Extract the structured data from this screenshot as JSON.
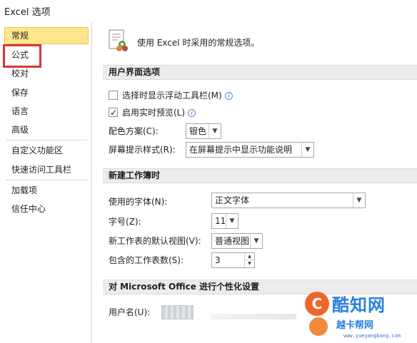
{
  "window": {
    "title": "Excel 选项"
  },
  "sidebar": {
    "items": [
      {
        "label": "常规"
      },
      {
        "label": "公式"
      },
      {
        "label": "校对"
      },
      {
        "label": "保存"
      },
      {
        "label": "语言"
      },
      {
        "label": "高级"
      },
      {
        "label": "自定义功能区"
      },
      {
        "label": "快速访问工具栏"
      },
      {
        "label": "加载项"
      },
      {
        "label": "信任中心"
      }
    ]
  },
  "header": {
    "text": "使用 Excel 时采用的常规选项。",
    "icon": "settings-options-icon"
  },
  "ui_section": {
    "title": "用户界面选项",
    "mini_toolbar_label": "选择时显示浮动工具栏(M)",
    "live_preview_label": "启用实时预览(L)",
    "color_scheme_label": "配色方案(C):",
    "color_scheme_value": "银色",
    "tooltip_style_label": "屏幕提示样式(R):",
    "tooltip_style_value": "在屏幕提示中显示功能说明",
    "info_symbol": "i"
  },
  "workbook_section": {
    "title": "新建工作簿时",
    "font_label": "使用的字体(N):",
    "font_value": "正文字体",
    "size_label": "字号(Z):",
    "size_value": "11",
    "view_label": "新工作表的默认视图(V):",
    "view_value": "普通视图",
    "sheets_label": "包含的工作表数(S):",
    "sheets_value": "3"
  },
  "personalize_section": {
    "title": "对 Microsoft Office 进行个性化设置",
    "username_label": "用户名(U):"
  },
  "watermark": {
    "title": "酷知网",
    "subtitle": "越卡帮网",
    "url": "www.yueyangbang.com",
    "logo_letter": "C",
    "colors": {
      "orange": "#f0662a",
      "blue": "#2b7fe0"
    }
  },
  "colors": {
    "selected_bg": "#fde78a",
    "highlight_box": "#d9343a",
    "section_bg": "#ececec"
  }
}
